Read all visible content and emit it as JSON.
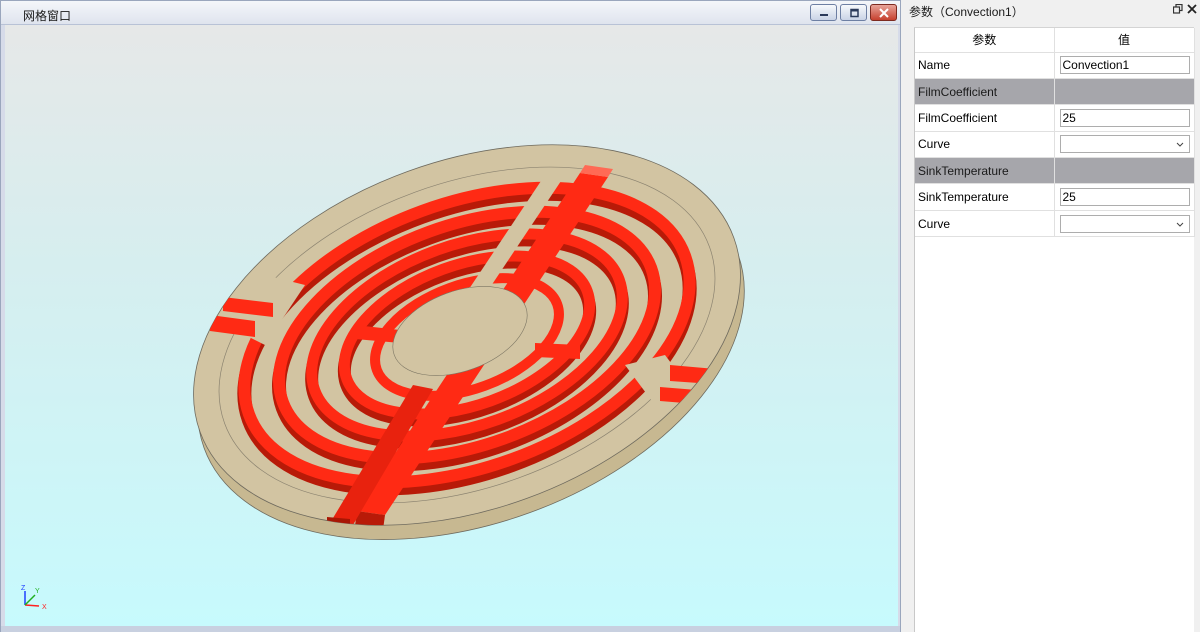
{
  "mesh_window": {
    "title": "网格窗口",
    "axes": {
      "x": "X",
      "y": "Y",
      "z": "Z"
    },
    "colors": {
      "channel": "#ff2a14",
      "disk": "#d2c4a2",
      "bg_top": "#e6e8e8",
      "bg_bottom": "#c7fafd"
    }
  },
  "param_panel": {
    "title": "参数（Convection1）",
    "header": {
      "param": "参数",
      "value": "值"
    },
    "rows": [
      {
        "label": "Name",
        "value": "Convection1",
        "kind": "text"
      },
      {
        "label": "FilmCoefficient",
        "value": "",
        "kind": "group"
      },
      {
        "label": "FilmCoefficient",
        "value": "25",
        "kind": "text"
      },
      {
        "label": "Curve",
        "value": "",
        "kind": "combo"
      },
      {
        "label": "SinkTemperature",
        "value": "",
        "kind": "group"
      },
      {
        "label": "SinkTemperature",
        "value": "25",
        "kind": "text"
      },
      {
        "label": "Curve",
        "value": "",
        "kind": "combo"
      }
    ]
  }
}
